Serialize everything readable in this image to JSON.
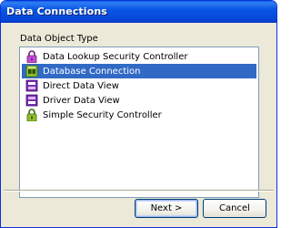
{
  "window": {
    "title": "Data Connections"
  },
  "group_label": "Data Object Type",
  "list": {
    "items": [
      {
        "label": "Data Lookup Security Controller",
        "icon": "lock-icon",
        "selected": false
      },
      {
        "label": "Database Connection",
        "icon": "database-connection-icon",
        "selected": true
      },
      {
        "label": "Direct Data View",
        "icon": "direct-data-view-icon",
        "selected": false
      },
      {
        "label": "Driver Data View",
        "icon": "driver-data-view-icon",
        "selected": false
      },
      {
        "label": "Simple Security Controller",
        "icon": "lock-icon",
        "selected": false
      }
    ]
  },
  "buttons": {
    "next_label": "Next >",
    "cancel_label": "Cancel"
  },
  "colors": {
    "titlebar": "#0a5fe8",
    "selection": "#316ac5",
    "lock_body": "#c44bd6",
    "db_icon": "#8fbf2a",
    "view_icon": "#7a2fb8"
  }
}
